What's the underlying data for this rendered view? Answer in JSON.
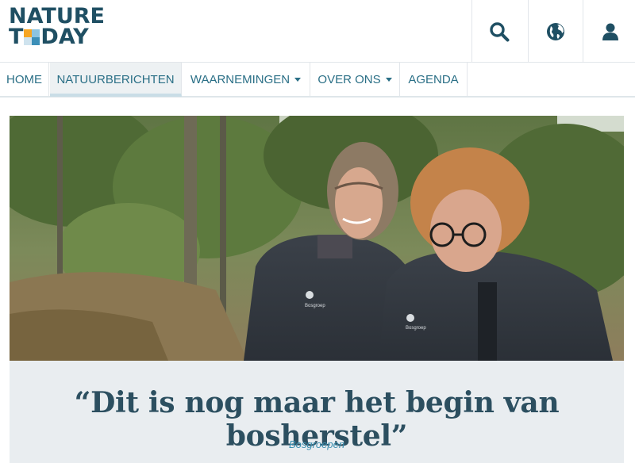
{
  "header": {
    "logo": {
      "line1": "NATURE",
      "line2_prefix": "T",
      "line2_suffix": "DAY"
    },
    "icons": [
      {
        "name": "search-icon"
      },
      {
        "name": "globe-icon"
      },
      {
        "name": "user-icon"
      }
    ]
  },
  "nav": {
    "items": [
      {
        "label": "HOME",
        "active": false,
        "dropdown": false
      },
      {
        "label": "NATUURBERICHTEN",
        "active": true,
        "dropdown": false
      },
      {
        "label": "WAARNEMINGEN",
        "active": false,
        "dropdown": true
      },
      {
        "label": "OVER ONS",
        "active": false,
        "dropdown": true
      },
      {
        "label": "AGENDA",
        "active": false,
        "dropdown": false
      }
    ]
  },
  "article": {
    "title": "“Dit is nog maar het begin van bosherstel”",
    "category": "Bosgroepen",
    "jacket_logo_text": "Bosgroep"
  },
  "colors": {
    "brand": "#1f4f63",
    "link": "#2a6f86",
    "category": "#3b8fb0",
    "panel": "#e9edf0"
  }
}
